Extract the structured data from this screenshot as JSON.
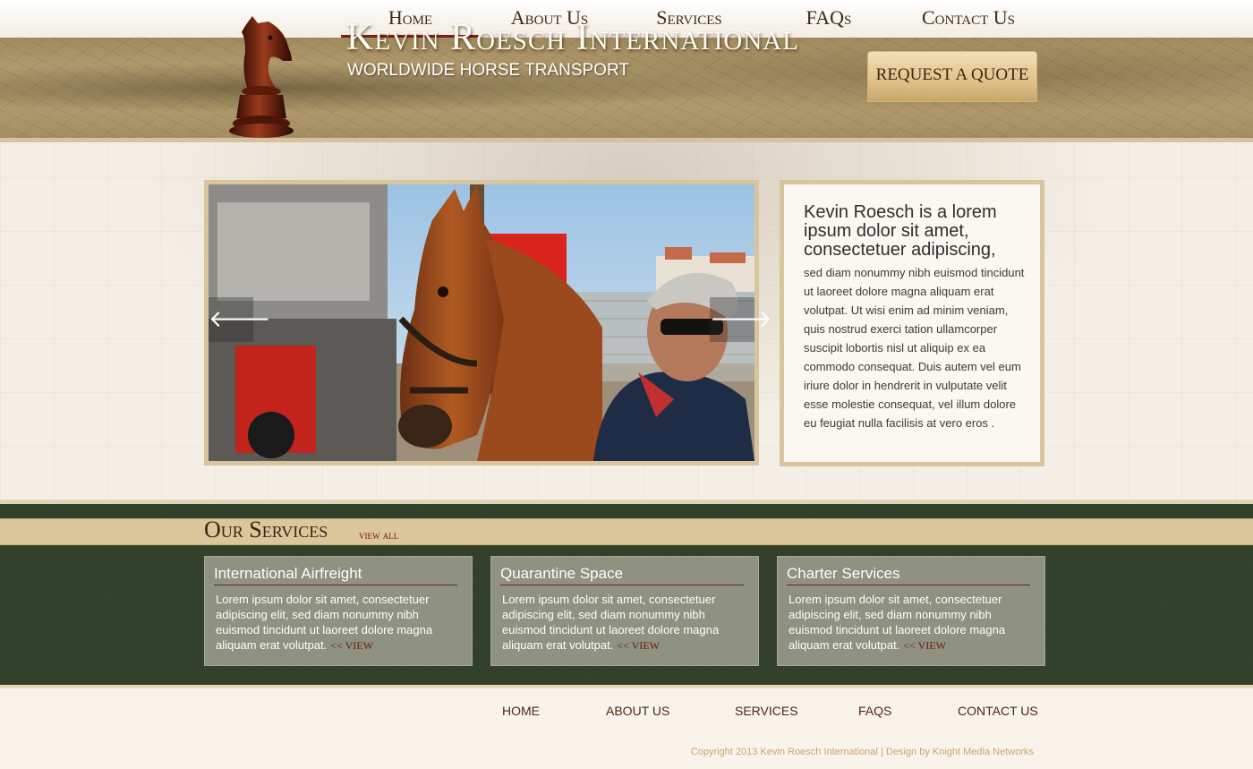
{
  "nav": {
    "items": [
      {
        "label": "Home",
        "active": true
      },
      {
        "label": "About Us",
        "active": false
      },
      {
        "label": "Services",
        "active": false
      },
      {
        "label": "FAQs",
        "active": false
      },
      {
        "label": "Contact Us",
        "active": false
      }
    ]
  },
  "header": {
    "title": "Kevin Roesch International",
    "subtitle": "WORLDWIDE HORSE TRANSPORT",
    "quote_button": "REQUEST A QUOTE",
    "logo_icon": "chess-knight-icon"
  },
  "slider": {
    "prev_icon": "arrow-left-icon",
    "next_icon": "arrow-right-icon",
    "prev_glyph": "🡐",
    "next_glyph": "🡒"
  },
  "intro": {
    "heading": "Kevin Roesch is a lorem ipsum dolor sit amet, consectetuer adipiscing,",
    "body": "sed diam nonummy nibh euismod tincidunt ut laoreet dolore magna aliquam erat volutpat. Ut wisi enim ad minim veniam, quis nostrud exerci tation ullamcorper suscipit lobortis nisl ut aliquip ex ea commodo consequat. Duis autem vel eum iriure dolor in hendrerit in vulputate velit esse molestie consequat, vel illum dolore eu feugiat nulla facilisis at vero eros ."
  },
  "services": {
    "title": "Our Services",
    "view_all": "view all",
    "cards": [
      {
        "title": "International Airfreight",
        "body": "Lorem ipsum dolor sit amet, consectetuer adipiscing elit, sed diam nonummy nibh euismod tincidunt ut laoreet dolore magna aliquam erat volutpat.",
        "link": "<< VIEW"
      },
      {
        "title": "Quarantine Space",
        "body": "Lorem ipsum dolor sit amet, consectetuer adipiscing elit, sed diam nonummy nibh euismod tincidunt ut laoreet dolore magna aliquam erat volutpat.",
        "link": "<< VIEW"
      },
      {
        "title": "Charter Services",
        "body": "Lorem ipsum dolor sit amet, consectetuer adipiscing elit, sed diam nonummy nibh euismod tincidunt ut laoreet dolore magna aliquam erat volutpat.",
        "link": "<< VIEW"
      }
    ]
  },
  "footer": {
    "nav": [
      "HOME",
      "ABOUT US",
      "SERVICES",
      "FAQS",
      "CONTACT US"
    ],
    "copyright": "Copyright 2013 Kevin Roesch International | Design by Knight Media Networks"
  },
  "colors": {
    "accent_dark_red": "#7b1f12",
    "header_tan": "#b9a476",
    "services_green": "#34422c",
    "card_gray": "#8f9181",
    "frame_tan": "#d8c59e"
  }
}
